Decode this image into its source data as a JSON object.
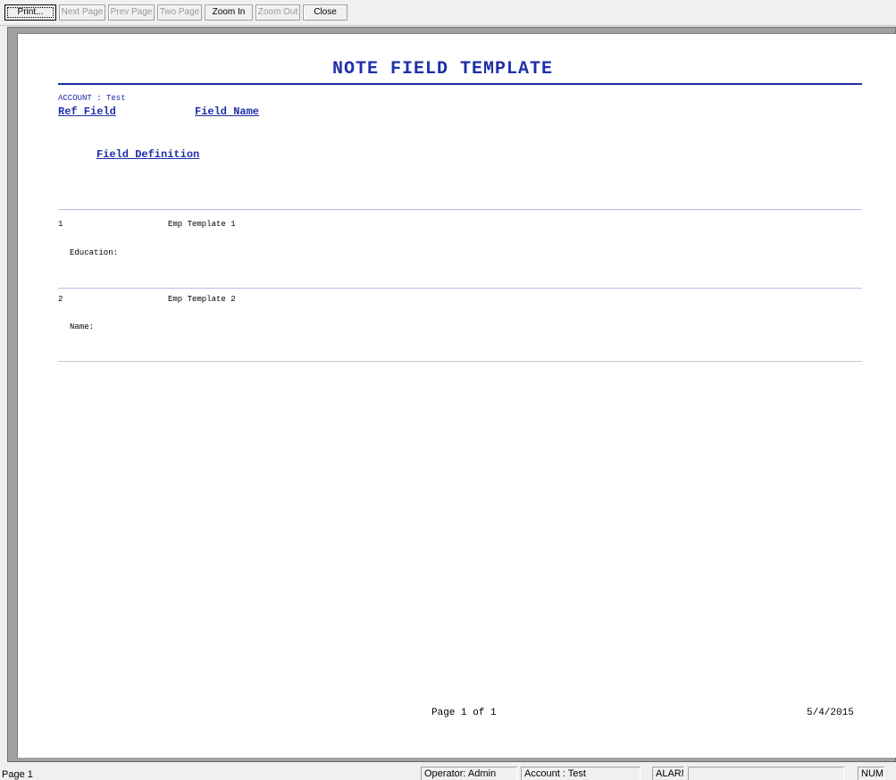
{
  "toolbar": {
    "print_label": "Print...",
    "next_page_label": "Next Page",
    "prev_page_label": "Prev Page",
    "two_page_label": "Two Page",
    "zoom_in_label": "Zoom In",
    "zoom_out_label": "Zoom Out",
    "close_label": "Close"
  },
  "report": {
    "title": "NOTE FIELD TEMPLATE",
    "account_line": "ACCOUNT : Test",
    "headers": {
      "ref_field": "Ref Field",
      "field_name": "Field Name",
      "field_definition": "Field Definition"
    },
    "rows": [
      {
        "ref": "1",
        "name": "Emp Template 1",
        "definition": "Education:"
      },
      {
        "ref": "2",
        "name": "Emp Template 2",
        "definition": "Name:"
      }
    ],
    "footer": {
      "page_info": "Page 1 of 1",
      "date": "5/4/2015"
    }
  },
  "statusbar": {
    "page": "Page 1",
    "operator": "Operator: Admin",
    "account": "Account : Test",
    "alarm": "ALARM",
    "empty": "",
    "num": "NUM"
  },
  "colors": {
    "report_accent": "#1f2fa8",
    "row_separator": "#b8bde0"
  }
}
